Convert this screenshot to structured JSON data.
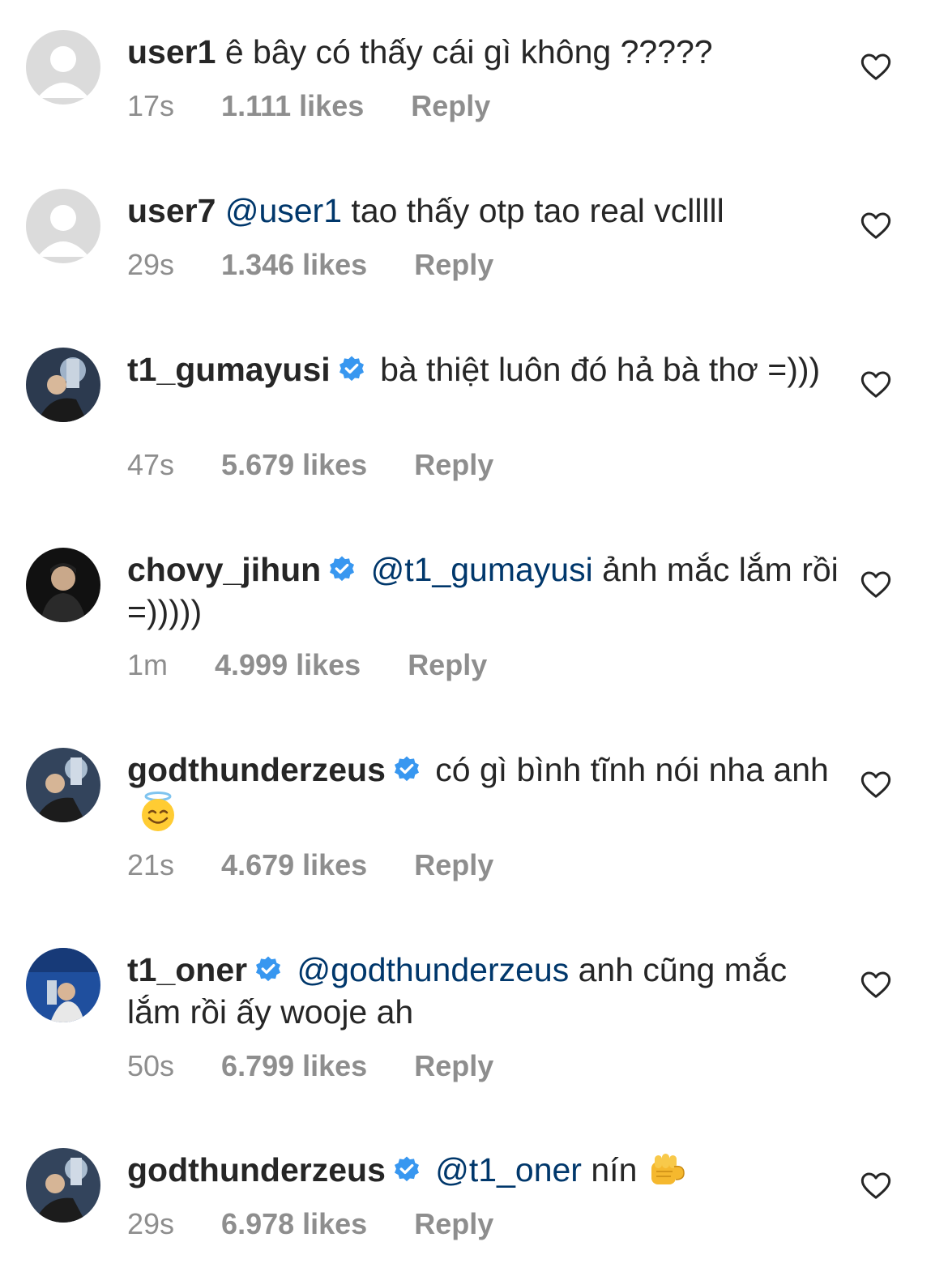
{
  "comments": [
    {
      "username": "user1",
      "verified": false,
      "mention": "",
      "text": "ê bây có thấy cái gì không ?????",
      "emoji": "",
      "time": "17s",
      "likes": "1.111 likes",
      "reply": "Reply",
      "avatar": "default-avatar"
    },
    {
      "username": "user7",
      "verified": false,
      "mention": "@user1",
      "text": "tao thấy otp tao real vclllll",
      "emoji": "",
      "time": "29s",
      "likes": "1.346 likes",
      "reply": "Reply",
      "avatar": "default-avatar"
    },
    {
      "username": "t1_gumayusi",
      "verified": true,
      "mention": "",
      "text": "bà thiệt luôn đó hả bà thơ =)))",
      "emoji": "",
      "time": "47s",
      "likes": "5.679 likes",
      "reply": "Reply",
      "avatar": "profile-photo"
    },
    {
      "username": "chovy_jihun",
      "verified": true,
      "mention": "@t1_gumayusi",
      "text": "ảnh mắc lắm rồi =)))))",
      "emoji": "",
      "time": "1m",
      "likes": "4.999 likes",
      "reply": "Reply",
      "avatar": "profile-photo"
    },
    {
      "username": "godthunderzeus",
      "verified": true,
      "mention": "",
      "text": "có gì bình tĩnh nói nha anh",
      "emoji": "smiling-face-with-halo",
      "time": "21s",
      "likes": "4.679 likes",
      "reply": "Reply",
      "avatar": "profile-photo"
    },
    {
      "username": "t1_oner",
      "verified": true,
      "mention": "@godthunderzeus",
      "text": "anh cũng mắc lắm rồi ấy wooje ah",
      "emoji": "",
      "time": "50s",
      "likes": "6.799 likes",
      "reply": "Reply",
      "avatar": "profile-photo"
    },
    {
      "username": "godthunderzeus",
      "verified": true,
      "mention": "@t1_oner",
      "text": "nín",
      "emoji": "fist-emoji",
      "time": "29s",
      "likes": "6.978 likes",
      "reply": "Reply",
      "avatar": "profile-photo"
    }
  ],
  "colors": {
    "text": "#262626",
    "meta": "#8e8e8e",
    "mention": "#00376b",
    "verified": "#3897f0"
  }
}
